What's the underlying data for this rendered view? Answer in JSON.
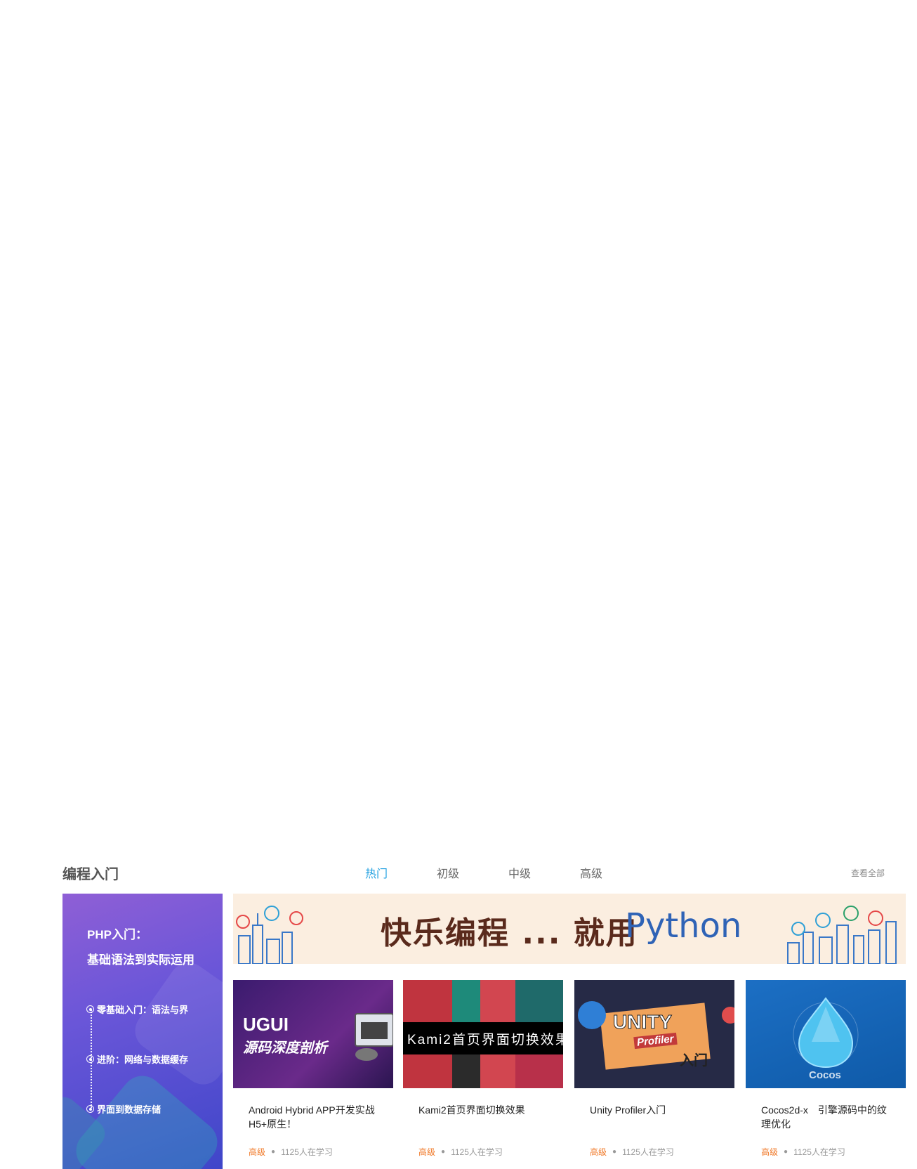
{
  "section": {
    "title": "编程入门",
    "tabs": [
      {
        "label": "热门",
        "active": true
      },
      {
        "label": "初级",
        "active": false
      },
      {
        "label": "中级",
        "active": false
      },
      {
        "label": "高级",
        "active": false
      }
    ],
    "view_all": "查看全部"
  },
  "promo": {
    "title_line1": "PHP入门：",
    "title_line2": "基础语法到实际运用",
    "steps": [
      "零基础入门：语法与界",
      "进阶：网络与数据缓存",
      "界面到数据存储"
    ]
  },
  "banner": {
    "text_cn": "快乐编程 ... 就用",
    "text_en": "Python"
  },
  "courses": [
    {
      "thumb_title1": "UGUI",
      "thumb_title2": "源码深度剖析",
      "title": "Android  Hybrid  APP开发实战 H5+原生！",
      "level": "高级",
      "learners": "1125人在学习"
    },
    {
      "thumb_title1": "Kami2首页界面切换效果",
      "title": "Kami2首页界面切换效果",
      "level": "高级",
      "learners": "1125人在学习"
    },
    {
      "thumb_title1": "UNITY",
      "thumb_title2": "Profiler",
      "thumb_title3": "入门",
      "title": "Unity Profiler入门",
      "level": "高级",
      "learners": "1125人在学习"
    },
    {
      "thumb_title1": "Cocos",
      "title": "Cocos2d-x　引擎源码中的纹理优化",
      "level": "高级",
      "learners": "1125人在学习"
    }
  ],
  "colors": {
    "accent_tab": "#1e9fe0",
    "level": "#f07a2a",
    "promo_gradient_start": "#8f5fd6",
    "promo_gradient_end": "#3f46c9",
    "banner_bg": "#fbeee0"
  }
}
